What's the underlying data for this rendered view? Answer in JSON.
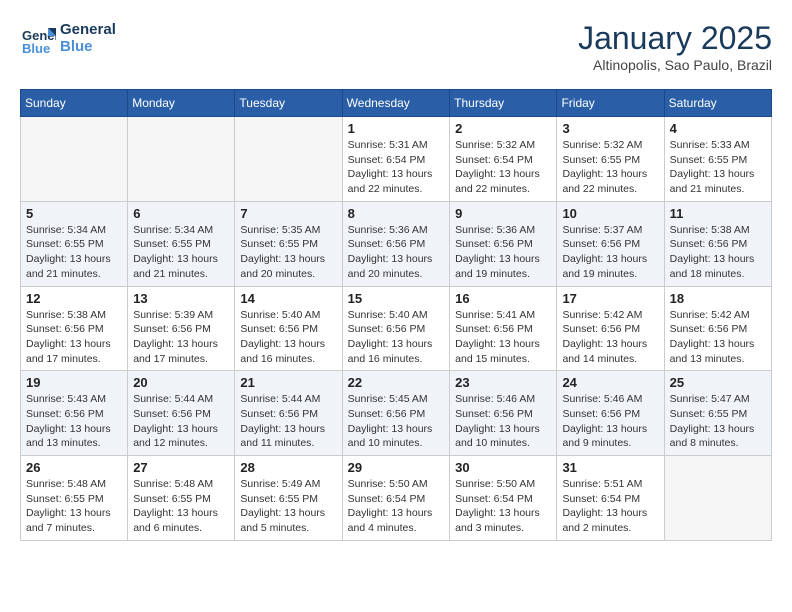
{
  "header": {
    "logo_line1": "General",
    "logo_line2": "Blue",
    "month": "January 2025",
    "location": "Altinopolis, Sao Paulo, Brazil"
  },
  "weekdays": [
    "Sunday",
    "Monday",
    "Tuesday",
    "Wednesday",
    "Thursday",
    "Friday",
    "Saturday"
  ],
  "weeks": [
    [
      {
        "day": "",
        "info": ""
      },
      {
        "day": "",
        "info": ""
      },
      {
        "day": "",
        "info": ""
      },
      {
        "day": "1",
        "info": "Sunrise: 5:31 AM\nSunset: 6:54 PM\nDaylight: 13 hours\nand 22 minutes."
      },
      {
        "day": "2",
        "info": "Sunrise: 5:32 AM\nSunset: 6:54 PM\nDaylight: 13 hours\nand 22 minutes."
      },
      {
        "day": "3",
        "info": "Sunrise: 5:32 AM\nSunset: 6:55 PM\nDaylight: 13 hours\nand 22 minutes."
      },
      {
        "day": "4",
        "info": "Sunrise: 5:33 AM\nSunset: 6:55 PM\nDaylight: 13 hours\nand 21 minutes."
      }
    ],
    [
      {
        "day": "5",
        "info": "Sunrise: 5:34 AM\nSunset: 6:55 PM\nDaylight: 13 hours\nand 21 minutes."
      },
      {
        "day": "6",
        "info": "Sunrise: 5:34 AM\nSunset: 6:55 PM\nDaylight: 13 hours\nand 21 minutes."
      },
      {
        "day": "7",
        "info": "Sunrise: 5:35 AM\nSunset: 6:55 PM\nDaylight: 13 hours\nand 20 minutes."
      },
      {
        "day": "8",
        "info": "Sunrise: 5:36 AM\nSunset: 6:56 PM\nDaylight: 13 hours\nand 20 minutes."
      },
      {
        "day": "9",
        "info": "Sunrise: 5:36 AM\nSunset: 6:56 PM\nDaylight: 13 hours\nand 19 minutes."
      },
      {
        "day": "10",
        "info": "Sunrise: 5:37 AM\nSunset: 6:56 PM\nDaylight: 13 hours\nand 19 minutes."
      },
      {
        "day": "11",
        "info": "Sunrise: 5:38 AM\nSunset: 6:56 PM\nDaylight: 13 hours\nand 18 minutes."
      }
    ],
    [
      {
        "day": "12",
        "info": "Sunrise: 5:38 AM\nSunset: 6:56 PM\nDaylight: 13 hours\nand 17 minutes."
      },
      {
        "day": "13",
        "info": "Sunrise: 5:39 AM\nSunset: 6:56 PM\nDaylight: 13 hours\nand 17 minutes."
      },
      {
        "day": "14",
        "info": "Sunrise: 5:40 AM\nSunset: 6:56 PM\nDaylight: 13 hours\nand 16 minutes."
      },
      {
        "day": "15",
        "info": "Sunrise: 5:40 AM\nSunset: 6:56 PM\nDaylight: 13 hours\nand 16 minutes."
      },
      {
        "day": "16",
        "info": "Sunrise: 5:41 AM\nSunset: 6:56 PM\nDaylight: 13 hours\nand 15 minutes."
      },
      {
        "day": "17",
        "info": "Sunrise: 5:42 AM\nSunset: 6:56 PM\nDaylight: 13 hours\nand 14 minutes."
      },
      {
        "day": "18",
        "info": "Sunrise: 5:42 AM\nSunset: 6:56 PM\nDaylight: 13 hours\nand 13 minutes."
      }
    ],
    [
      {
        "day": "19",
        "info": "Sunrise: 5:43 AM\nSunset: 6:56 PM\nDaylight: 13 hours\nand 13 minutes."
      },
      {
        "day": "20",
        "info": "Sunrise: 5:44 AM\nSunset: 6:56 PM\nDaylight: 13 hours\nand 12 minutes."
      },
      {
        "day": "21",
        "info": "Sunrise: 5:44 AM\nSunset: 6:56 PM\nDaylight: 13 hours\nand 11 minutes."
      },
      {
        "day": "22",
        "info": "Sunrise: 5:45 AM\nSunset: 6:56 PM\nDaylight: 13 hours\nand 10 minutes."
      },
      {
        "day": "23",
        "info": "Sunrise: 5:46 AM\nSunset: 6:56 PM\nDaylight: 13 hours\nand 10 minutes."
      },
      {
        "day": "24",
        "info": "Sunrise: 5:46 AM\nSunset: 6:56 PM\nDaylight: 13 hours\nand 9 minutes."
      },
      {
        "day": "25",
        "info": "Sunrise: 5:47 AM\nSunset: 6:55 PM\nDaylight: 13 hours\nand 8 minutes."
      }
    ],
    [
      {
        "day": "26",
        "info": "Sunrise: 5:48 AM\nSunset: 6:55 PM\nDaylight: 13 hours\nand 7 minutes."
      },
      {
        "day": "27",
        "info": "Sunrise: 5:48 AM\nSunset: 6:55 PM\nDaylight: 13 hours\nand 6 minutes."
      },
      {
        "day": "28",
        "info": "Sunrise: 5:49 AM\nSunset: 6:55 PM\nDaylight: 13 hours\nand 5 minutes."
      },
      {
        "day": "29",
        "info": "Sunrise: 5:50 AM\nSunset: 6:54 PM\nDaylight: 13 hours\nand 4 minutes."
      },
      {
        "day": "30",
        "info": "Sunrise: 5:50 AM\nSunset: 6:54 PM\nDaylight: 13 hours\nand 3 minutes."
      },
      {
        "day": "31",
        "info": "Sunrise: 5:51 AM\nSunset: 6:54 PM\nDaylight: 13 hours\nand 2 minutes."
      },
      {
        "day": "",
        "info": ""
      }
    ]
  ]
}
